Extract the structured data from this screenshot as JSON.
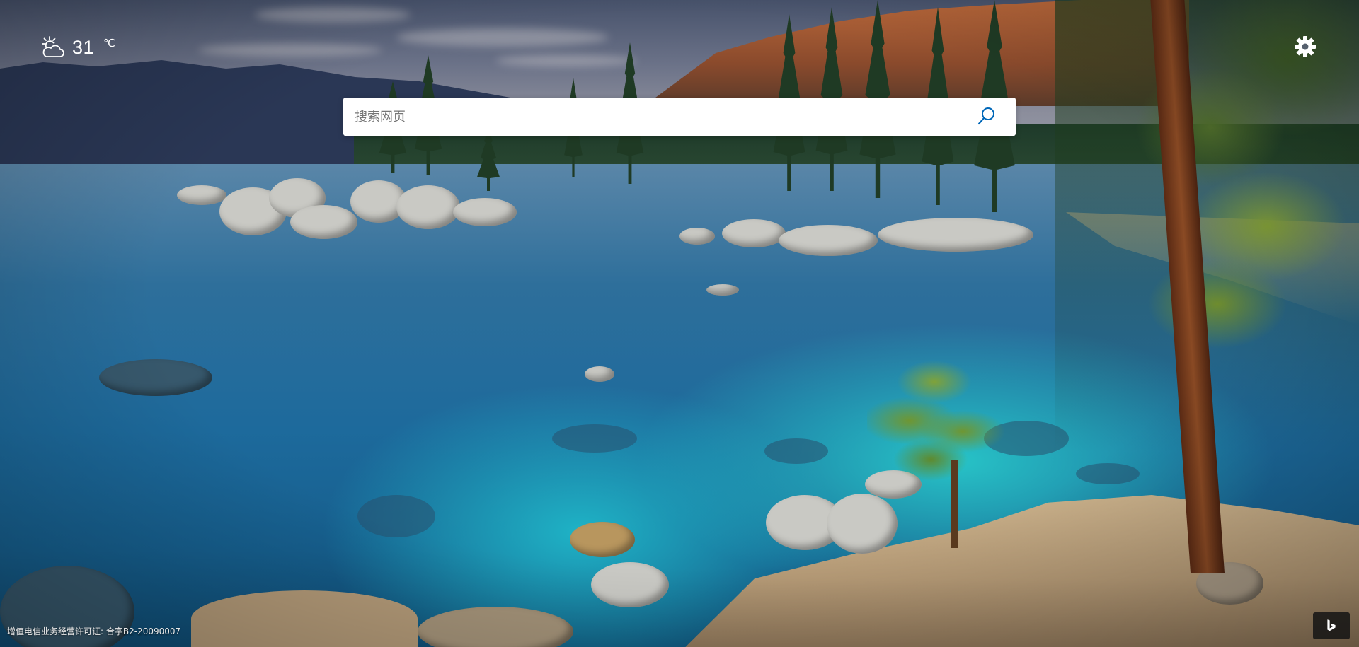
{
  "weather": {
    "icon": "partly-cloudy-day-icon",
    "temperature": "31",
    "unit": "℃"
  },
  "search": {
    "placeholder": "搜索网页",
    "value": "",
    "button_icon": "search-icon"
  },
  "settings": {
    "icon": "gear-icon"
  },
  "footer": {
    "license_text": "增值电信业务经营许可证: 合字B2-20090007",
    "brand_button_icon": "bing-logo-icon"
  },
  "colors": {
    "accent": "#0067b8",
    "search_bg": "#ffffff",
    "overlay_text": "#ffffff"
  }
}
